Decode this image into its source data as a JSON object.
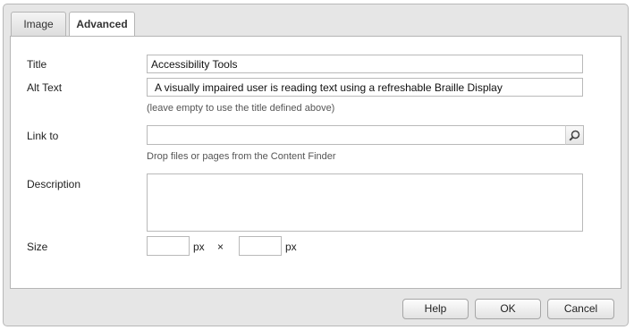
{
  "tabs": [
    {
      "label": "Image",
      "active": false
    },
    {
      "label": "Advanced",
      "active": true
    }
  ],
  "form": {
    "title": {
      "label": "Title",
      "value": "Accessibility Tools"
    },
    "alt_text": {
      "label": "Alt Text",
      "value": "A visually impaired user is reading text using a refreshable Braille Display",
      "hint": "(leave empty to use the title defined above)"
    },
    "link_to": {
      "label": "Link to",
      "value": "",
      "hint": "Drop files or pages from the Content Finder",
      "button_icon": "search-icon"
    },
    "description": {
      "label": "Description",
      "value": ""
    },
    "size": {
      "label": "Size",
      "width": "",
      "height": "",
      "unit": "px",
      "separator": "×"
    }
  },
  "buttons": {
    "help": "Help",
    "ok": "OK",
    "cancel": "Cancel"
  },
  "colors": {
    "dialog_bg": "#e6e6e6",
    "panel_bg": "#ffffff",
    "border": "#b5b5b5"
  }
}
